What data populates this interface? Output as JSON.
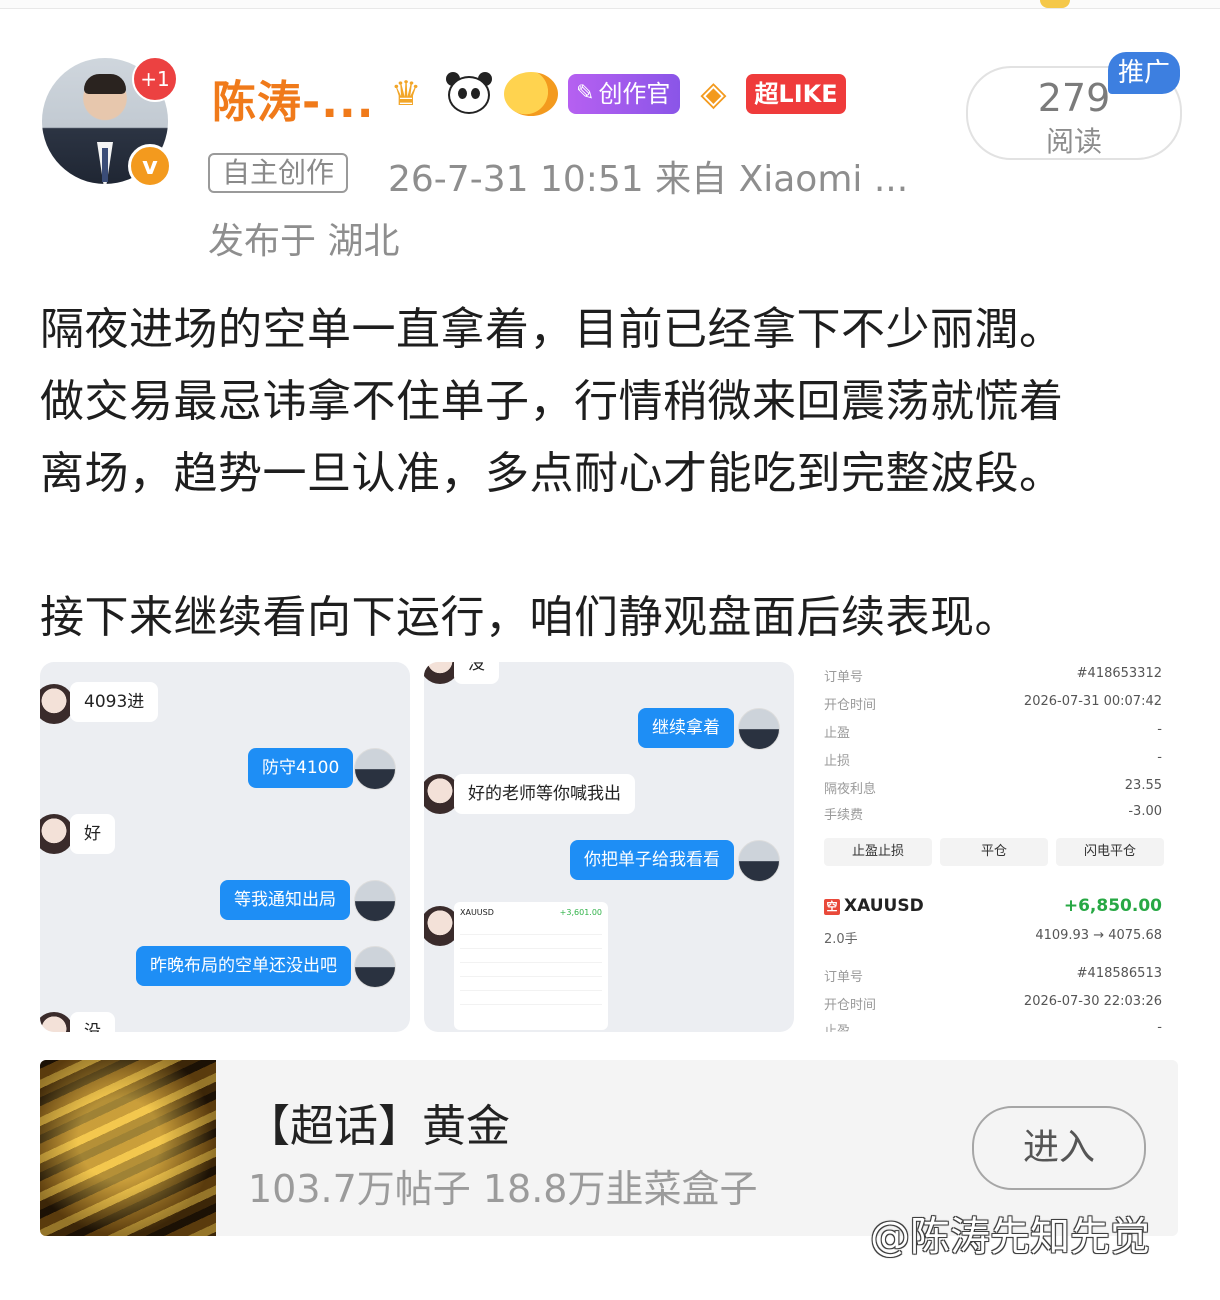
{
  "post": {
    "author": "陈涛-...",
    "plus_badge": "+1",
    "verified_badge": "v",
    "badges": {
      "creator": "创作官",
      "like": "超LIKE"
    },
    "tag": "自主创作",
    "time_source": "26-7-31 10:51  来自 Xiaomi ...",
    "location": "发布于 湖北",
    "reads": {
      "count": "279",
      "label": "阅读",
      "promo": "推广"
    },
    "paragraphs": [
      "隔夜进场的空单一直拿着，目前已经拿下不少丽潤。",
      "做交易最忌讳拿不住单子，行情稍微来回震荡就慌着",
      "离场，趋势一旦认准，多点耐心才能吃到完整波段。",
      "接下来继续看向下运行，咱们静观盘面后续表现。"
    ]
  },
  "chat1": {
    "messages": [
      "4093进",
      "防守4100",
      "好",
      "等我通知出局",
      "昨晚布局的空单还没出吧",
      "没"
    ]
  },
  "chat2": {
    "messages": [
      "没",
      "继续拿着",
      "好的老师等你喊我出",
      "你把单子给我看看"
    ],
    "mini": {
      "symbol": "XAUUSD",
      "pnl": "+3,601.00"
    }
  },
  "order": {
    "rows": [
      {
        "label": "订单号",
        "value": "#418653312"
      },
      {
        "label": "开仓时间",
        "value": "2026-07-31 00:07:42"
      },
      {
        "label": "止盈",
        "value": "-"
      },
      {
        "label": "止损",
        "value": "-"
      },
      {
        "label": "隔夜利息",
        "value": "23.55"
      },
      {
        "label": "手续费",
        "value": "-3.00"
      }
    ],
    "buttons": [
      "止盈止损",
      "平仓",
      "闪电平仓"
    ],
    "position": {
      "side": "空",
      "symbol": "XAUUSD",
      "pnl": "+6,850.00",
      "lots": "2.0手",
      "prices": "4109.93 → 4075.68"
    },
    "rows2": [
      {
        "label": "订单号",
        "value": "#418586513"
      },
      {
        "label": "开仓时间",
        "value": "2026-07-30 22:03:26"
      },
      {
        "label": "止盈",
        "value": "-"
      }
    ]
  },
  "topic": {
    "title": "【超话】黄金",
    "stats": "103.7万帖子 18.8万韭菜盒子",
    "enter": "进入"
  },
  "watermark": "@陈涛先知先觉",
  "colors": {
    "accent_orange": "#f07a1a",
    "bubble_blue": "#1e8ef5",
    "profit_green": "#27a844"
  }
}
